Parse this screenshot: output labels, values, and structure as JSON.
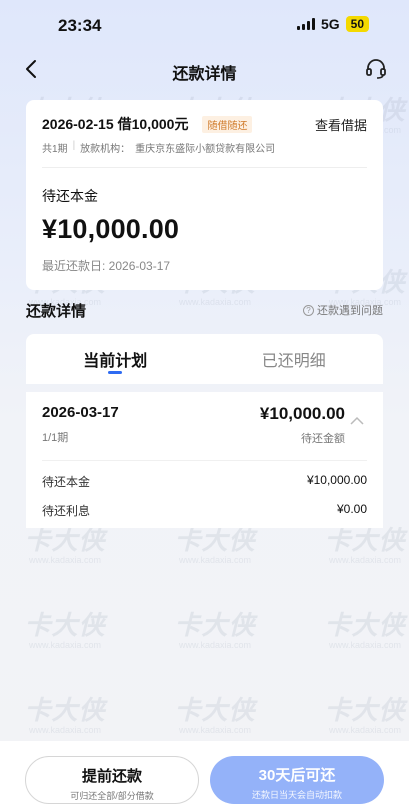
{
  "status_bar": {
    "time": "23:34",
    "network": "5G",
    "battery": "50"
  },
  "nav": {
    "title": "还款详情",
    "back_icon": "chevron-left-icon",
    "service_icon": "headset-icon"
  },
  "loan": {
    "date": "2026-02-15",
    "amount": "借10,000元",
    "tag": "随借随还",
    "view_label": "查看借据",
    "periods": "共1期",
    "lender_label": "放款机构：",
    "lender_name": "重庆京东盛际小额贷款有限公司",
    "principal_label": "待还本金",
    "principal_value": "¥10,000.00",
    "latest_date": "最近还款日: 2026-03-17"
  },
  "section": {
    "title": "还款详情",
    "problem_link": "还款遇到问题"
  },
  "tabs": [
    {
      "label": "当前计划",
      "active": true
    },
    {
      "label": "已还明细",
      "active": false
    }
  ],
  "plan": {
    "date": "2026-03-17",
    "period": "1/1期",
    "amount": "¥10,000.00",
    "status": "待还金额",
    "rows": [
      {
        "label": "待还本金",
        "value": "¥10,000.00"
      },
      {
        "label": "待还利息",
        "value": "¥0.00"
      }
    ]
  },
  "bottom": {
    "early_main": "提前还款",
    "early_sub": "可归还全部/部分借款",
    "auto_main": "30天后可还",
    "auto_sub": "还款日当天会自动扣款"
  },
  "watermark": {
    "text": "卡大侠",
    "url": "www.kadaxia.com"
  },
  "colors": {
    "accent": "#2f6bf2",
    "disabled_button": "#94b2f9",
    "tag_text": "#d07a2a"
  }
}
